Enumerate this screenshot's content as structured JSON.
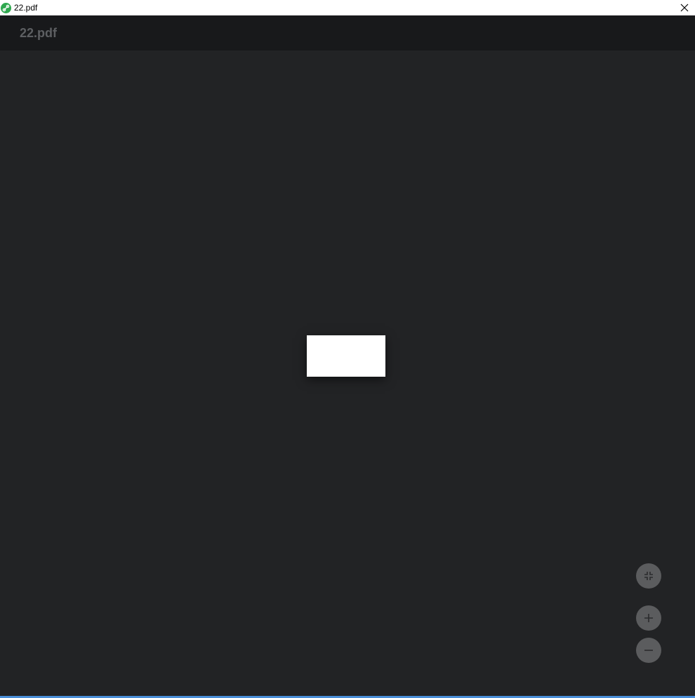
{
  "window": {
    "title": "22.pdf",
    "app_icon": "pdf-link-icon",
    "close_icon": "close-icon"
  },
  "viewer": {
    "document_title": "22.pdf",
    "controls": {
      "fit": {
        "icon": "fit-to-page-icon"
      },
      "zoom_in": {
        "icon": "plus-icon"
      },
      "zoom_out": {
        "icon": "minus-icon"
      }
    }
  },
  "colors": {
    "background": "#222325",
    "header": "#18191b",
    "title_text": "#5d5f62",
    "fab": "#5b5c5e",
    "app_icon": "#2fa84f",
    "accent_line": "#4a8fd9"
  }
}
